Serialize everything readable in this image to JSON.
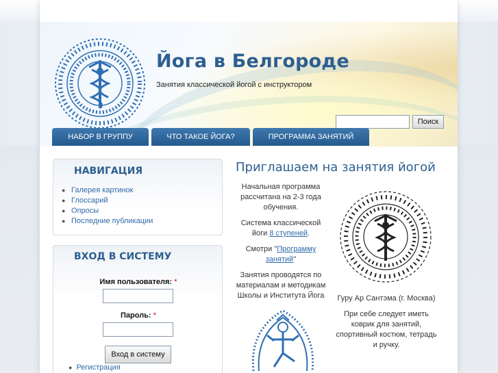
{
  "header": {
    "site_title": "Йога в Белгороде",
    "site_slogan": "Занятия классической йогой с инструктором",
    "search_button": "Поиск",
    "search_value": ""
  },
  "tabs": [
    {
      "label": "НАБОР В ГРУППУ"
    },
    {
      "label": "ЧТО ТАКОЕ ЙОГА?"
    },
    {
      "label": "ПРОГРАММА ЗАНЯТИЙ"
    }
  ],
  "sidebar": {
    "navigation": {
      "title": "НАВИГАЦИЯ",
      "items": [
        "Галерея картинок",
        "Глоссарий",
        "Опросы",
        "Последние публикации"
      ]
    },
    "login": {
      "title": "ВХОД В СИСТЕМУ",
      "username_label": "Имя пользователя:",
      "password_label": "Пароль:",
      "required_mark": "*",
      "submit_label": "Вход в систему",
      "register_link": "Регистрация"
    }
  },
  "content": {
    "title": "Приглашаем на занятия йогой",
    "left": {
      "p1": "Начальная программа рассчитана на 2-3 года обучения.",
      "p2_prefix": "Система классической йоги",
      "p2_link": "8 ступеней",
      "p2_suffix": ".",
      "p3_prefix": "Смотри \"",
      "p3_link": "Программу занятий",
      "p3_suffix": "\"",
      "p4": "Занятия проводятся по материалам и методикам Школы и Института Йога"
    },
    "right": {
      "caption": "Гуру Ар Сантэма (г. Москва)",
      "note": "При себе следует иметь коврик для занятий, спортивный костюм, тетрадь и ручку."
    }
  },
  "colors": {
    "accent": "#2d5f91",
    "tab_bg": "#2e669c",
    "link": "#2d6aa8"
  }
}
